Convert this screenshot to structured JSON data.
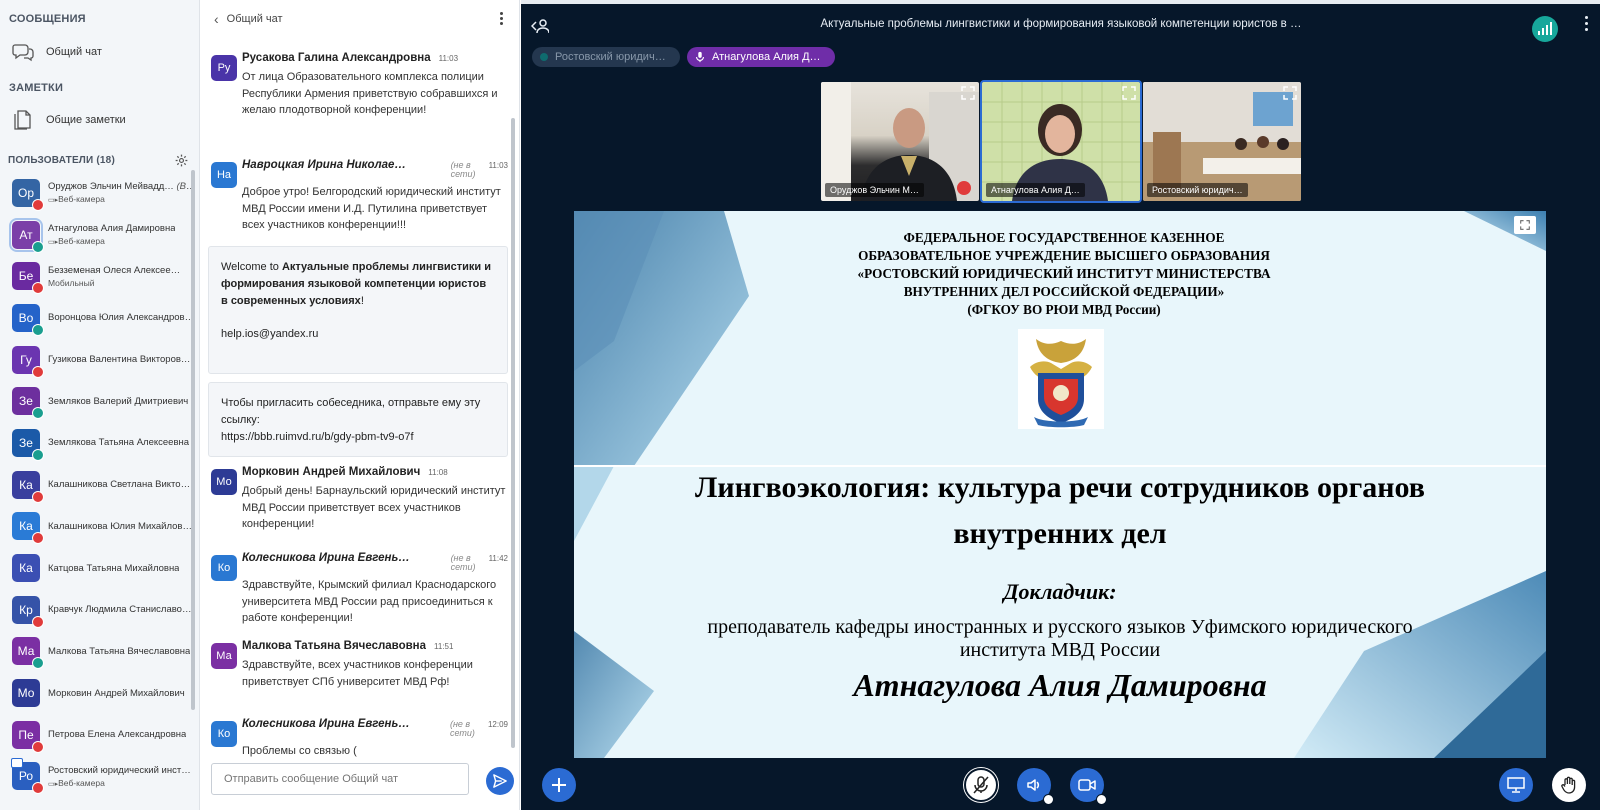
{
  "left": {
    "messages_title": "СООБЩЕНИЯ",
    "public_chat": "Общий чат",
    "notes_title": "ЗАМЕТКИ",
    "shared_notes": "Общие заметки",
    "users_title": "ПОЛЬЗОВАТЕЛИ (18)",
    "users": [
      {
        "initials": "Ор",
        "name": "Оруджов Эльчин Мейвадд…",
        "you": "(Вы)",
        "sub": "Веб-камера",
        "color": "#3465a4",
        "badge": "red"
      },
      {
        "initials": "Ат",
        "name": "Атнагулова Алия Дамировна",
        "you": "",
        "sub": "Веб-камера",
        "color": "#7b3fa8",
        "badge": "green",
        "selected": true
      },
      {
        "initials": "Бе",
        "name": "Безземеная Олеся Алексее…",
        "you": "",
        "sub": "Мобильный",
        "color": "#6a2aa0",
        "badge": "red"
      },
      {
        "initials": "Во",
        "name": "Воронцова Юлия Александров…",
        "you": "",
        "sub": "",
        "color": "#2563c9",
        "badge": "green"
      },
      {
        "initials": "Гу",
        "name": "Гузикова Валентина Викторов…",
        "you": "",
        "sub": "",
        "color": "#6b35b0",
        "badge": "red"
      },
      {
        "initials": "Зе",
        "name": "Земляков Валерий Дмитриевич",
        "you": "",
        "sub": "",
        "color": "#6d2f9e",
        "badge": "green"
      },
      {
        "initials": "Зе",
        "name": "Землякова Татьяна Алексеевна",
        "you": "",
        "sub": "",
        "color": "#1b5aa8",
        "badge": "green"
      },
      {
        "initials": "Ка",
        "name": "Калашникова Светлана Викто…",
        "you": "",
        "sub": "",
        "color": "#3a3f9e",
        "badge": "red"
      },
      {
        "initials": "Ка",
        "name": "Калашникова Юлия Михайлов…",
        "you": "",
        "sub": "",
        "color": "#2a7bd6",
        "badge": "red"
      },
      {
        "initials": "Ка",
        "name": "Катцова Татьяна Михайловна",
        "you": "",
        "sub": "",
        "color": "#3b4fb3",
        "badge": ""
      },
      {
        "initials": "Кр",
        "name": "Кравчук Людмила Станиславо…",
        "you": "",
        "sub": "",
        "color": "#3553a8",
        "badge": "red"
      },
      {
        "initials": "Ма",
        "name": "Малкова Татьяна Вячеславовна",
        "you": "",
        "sub": "",
        "color": "#7b2fa3",
        "badge": "green"
      },
      {
        "initials": "Мо",
        "name": "Морковин Андрей Михайлович",
        "you": "",
        "sub": "",
        "color": "#2d3b95",
        "badge": ""
      },
      {
        "initials": "Пе",
        "name": "Петрова Елена Александровна",
        "you": "",
        "sub": "",
        "color": "#7b2fa3",
        "badge": "red"
      },
      {
        "initials": "Ро",
        "name": "Ростовский юридический инст…",
        "you": "",
        "sub": "Веб-камера",
        "color": "#2a5fc0",
        "badge": "red"
      }
    ]
  },
  "chat": {
    "title": "Общий чат",
    "input_placeholder": "Отправить сообщение Общий чат",
    "offline_label": "(не в сети)",
    "messages": [
      {
        "initials": "Ру",
        "color": "#4a34a8",
        "author": "Русакова Галина Александровна",
        "time": "11:03",
        "offline": false,
        "text": "От лица Образовательного комплекса полиции Республики Армения приветствую собравшихся и желаю плодотворной конференции!"
      },
      {
        "initials": "На",
        "color": "#2a78d2",
        "author": "Навроцкая Ирина Николае…",
        "time": "11:03",
        "offline": true,
        "text": "Доброе утро! Белгородский юридический институт МВД России имени И.Д. Путилина приветствует всех участников конференции!!!"
      },
      {
        "initials": "Мо",
        "color": "#2d3b95",
        "author": "Морковин Андрей Михайлович",
        "time": "11:08",
        "offline": false,
        "text": "Добрый день! Барнаульский юридический институт МВД России приветствует всех участников конференции!"
      },
      {
        "initials": "Ко",
        "color": "#2a78d2",
        "author": "Колесникова Ирина Евгень…",
        "time": "11:42",
        "offline": true,
        "text": "Здравствуйте, Крымский филиал Краснодарского университета МВД России рад присоединиться к работе конференции!"
      },
      {
        "initials": "Ма",
        "color": "#7b2fa3",
        "author": "Малкова Татьяна Вячеславовна",
        "time": "11:51",
        "offline": false,
        "text": "Здравствуйте, всех участников конференции приветствует СПб университет МВД Рф!"
      },
      {
        "initials": "Ко",
        "color": "#2a78d2",
        "author": "Колесникова Ирина Евгень…",
        "time": "12:09",
        "offline": true,
        "text": "Проблемы со связью ("
      }
    ],
    "welcome": {
      "prefix": "Welcome to ",
      "conference": "Актуальные проблемы лингвистики и формирования языковой компетенции юристов в современных условиях",
      "suffix": "!",
      "email": "help.ios@yandex.ru"
    },
    "invite": {
      "text": "Чтобы пригласить собеседника, отправьте ему эту ссылку:",
      "link": "https://bbb.ruimvd.ru/b/gdy-pbm-tv9-o7f"
    }
  },
  "main": {
    "meeting_title": "Актуальные проблемы лингвистики и формирования языковой компетенции юристов в …",
    "talkers": [
      {
        "label": "Ростовский юридич…",
        "active": false
      },
      {
        "label": "Атнагулова Алия Д…",
        "active": true
      }
    ],
    "cams": [
      {
        "label": "Оруджов Эльчин М…",
        "muted": true
      },
      {
        "label": "Атнагулова Алия Д…",
        "muted": false,
        "active": true
      },
      {
        "label": "Ростовский юридич…",
        "muted": false
      }
    ],
    "slide": {
      "org_line1": "ФЕДЕРАЛЬНОЕ ГОСУДАРСТВЕННОЕ КАЗЕННОЕ",
      "org_line2": "ОБРАЗОВАТЕЛЬНОЕ УЧРЕЖДЕНИЕ ВЫСШЕГО ОБРАЗОВАНИЯ",
      "org_line3": "«РОСТОВСКИЙ ЮРИДИЧЕСКИЙ ИНСТИТУТ МИНИСТЕРСТВА",
      "org_line4": "ВНУТРЕННИХ ДЕЛ РОССИЙСКОЙ ФЕДЕРАЦИИ»",
      "org_line5": "(ФГКОУ ВО РЮИ МВД России)",
      "topic": "Лингвоэкология: культура речи сотрудников органов внутренних дел",
      "speaker_label": "Докладчик:",
      "speaker_role": "преподаватель кафедры иностранных и русского языков Уфимского юридического института МВД России",
      "speaker_name": "Атнагулова Алия Дамировна"
    }
  },
  "colors": {
    "accent": "#2b6bd3",
    "main_bg": "#06172a",
    "talker_active": "#6f2da8",
    "connection": "#17a79b",
    "muted": "#e03b3b"
  }
}
